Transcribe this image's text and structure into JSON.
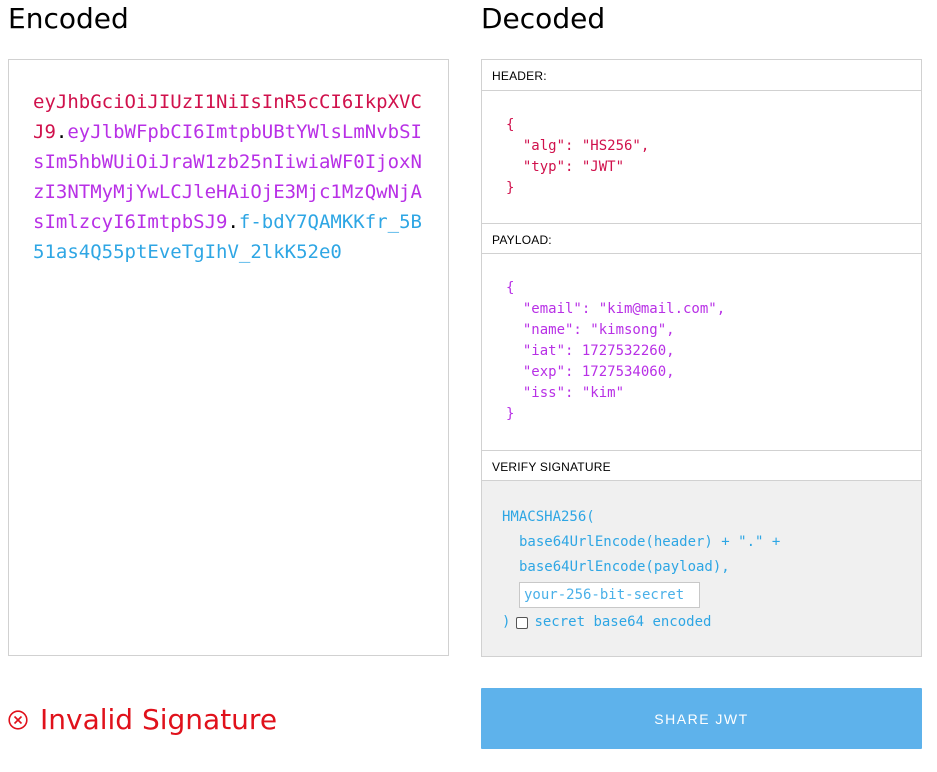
{
  "encoded": {
    "title": "Encoded",
    "token_header": "eyJhbGciOiJIUzI1NiIsInR5cCI6IkpXVCJ9",
    "token_payload": "eyJlbWFpbCI6ImtpbUBtYWlsLmNvbSIsIm5hbWUiOiJraW1zb25nIiwiaWF0IjoxNzI3NTMyMjYwLCJleHAiOjE3Mjc1MzQwNjAsImlzcyI6ImtpbSJ9",
    "token_signature": "f-bdY7QAMKKfr_5B51as4Q55ptEveTgIhV_2lkK52e0",
    "dot": "."
  },
  "decoded": {
    "title": "Decoded",
    "header": {
      "label": "HEADER:",
      "lines": [
        "{",
        "  \"alg\": \"HS256\",",
        "  \"typ\": \"JWT\"",
        "}"
      ]
    },
    "payload": {
      "label": "PAYLOAD:",
      "lines": [
        "{",
        "  \"email\": \"kim@mail.com\",",
        "  \"name\": \"kimsong\",",
        "  \"iat\": 1727532260,",
        "  \"exp\": 1727534060,",
        "  \"iss\": \"kim\"",
        "}"
      ]
    },
    "verify": {
      "label": "VERIFY SIGNATURE",
      "fn_open": "HMACSHA256(",
      "line1": "base64UrlEncode(header) + \".\" +",
      "line2": "base64UrlEncode(payload),",
      "secret_placeholder": "your-256-bit-secret",
      "secret_value": "",
      "close": ")",
      "checkbox_label": "secret base64 encoded",
      "checkbox_checked": false
    }
  },
  "status": {
    "text": "Invalid Signature",
    "icon": "x-circle-icon",
    "color": "#e0111b"
  },
  "share_button": {
    "label": "SHARE JWT"
  },
  "colors": {
    "header": "#d0114c",
    "payload": "#b830e6",
    "signature": "#2ea6e4",
    "share_bg": "#5eb2eb"
  }
}
